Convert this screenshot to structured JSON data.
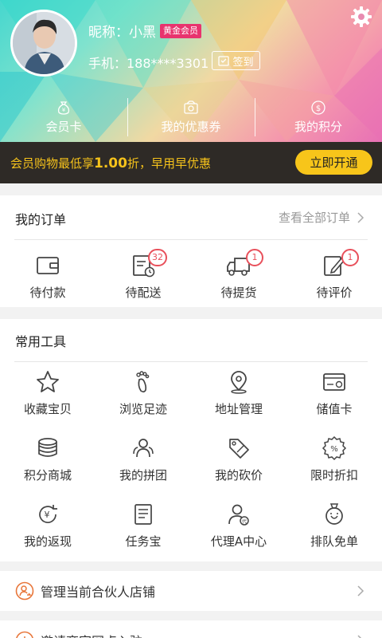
{
  "profile": {
    "nickname": "昵称：小黑",
    "member_badge": "黄金会员",
    "phone": "手机：188****3301",
    "signin_label": "签到"
  },
  "stats": [
    {
      "label": "会员卡",
      "icon": "money-bag-icon"
    },
    {
      "label": "我的优惠券",
      "icon": "coupon-icon"
    },
    {
      "label": "我的积分",
      "icon": "dollar-coin-icon"
    }
  ],
  "promo": {
    "text_prefix": "会员购物最低享",
    "text_value": "1.00",
    "text_suffix": "折，早用早优惠",
    "button_label": "立即开通"
  },
  "orders": {
    "title": "我的订单",
    "view_all": "查看全部订单",
    "items": [
      {
        "label": "待付款",
        "icon": "wallet-icon",
        "badge": ""
      },
      {
        "label": "待配送",
        "icon": "delivery-list-icon",
        "badge": "32"
      },
      {
        "label": "待提货",
        "icon": "truck-icon",
        "badge": "1"
      },
      {
        "label": "待评价",
        "icon": "edit-review-icon",
        "badge": "1"
      }
    ]
  },
  "tools": {
    "title": "常用工具",
    "items": [
      {
        "label": "收藏宝贝",
        "icon": "star-icon"
      },
      {
        "label": "浏览足迹",
        "icon": "footprint-icon"
      },
      {
        "label": "地址管理",
        "icon": "location-pin-icon"
      },
      {
        "label": "储值卡",
        "icon": "stored-value-card-icon"
      },
      {
        "label": "积分商城",
        "icon": "coin-stack-icon"
      },
      {
        "label": "我的拼团",
        "icon": "group-icon"
      },
      {
        "label": "我的砍价",
        "icon": "price-tag-icon"
      },
      {
        "label": "限时折扣",
        "icon": "discount-icon"
      },
      {
        "label": "我的返现",
        "icon": "cashback-icon"
      },
      {
        "label": "任务宝",
        "icon": "task-list-icon"
      },
      {
        "label": "代理A中心",
        "icon": "agent-icon"
      },
      {
        "label": "排队免单",
        "icon": "queue-icon"
      }
    ]
  },
  "rows": [
    {
      "label": "管理当前合伙人店铺",
      "icon": "partner-user-icon"
    },
    {
      "label": "邀请商家网点入驻",
      "icon": "invite-icon"
    }
  ],
  "colors": {
    "accent": "#f7c51a",
    "badge": "#e8505b",
    "promo_bg": "#2e2a26",
    "member_badge": "#e8336e"
  }
}
